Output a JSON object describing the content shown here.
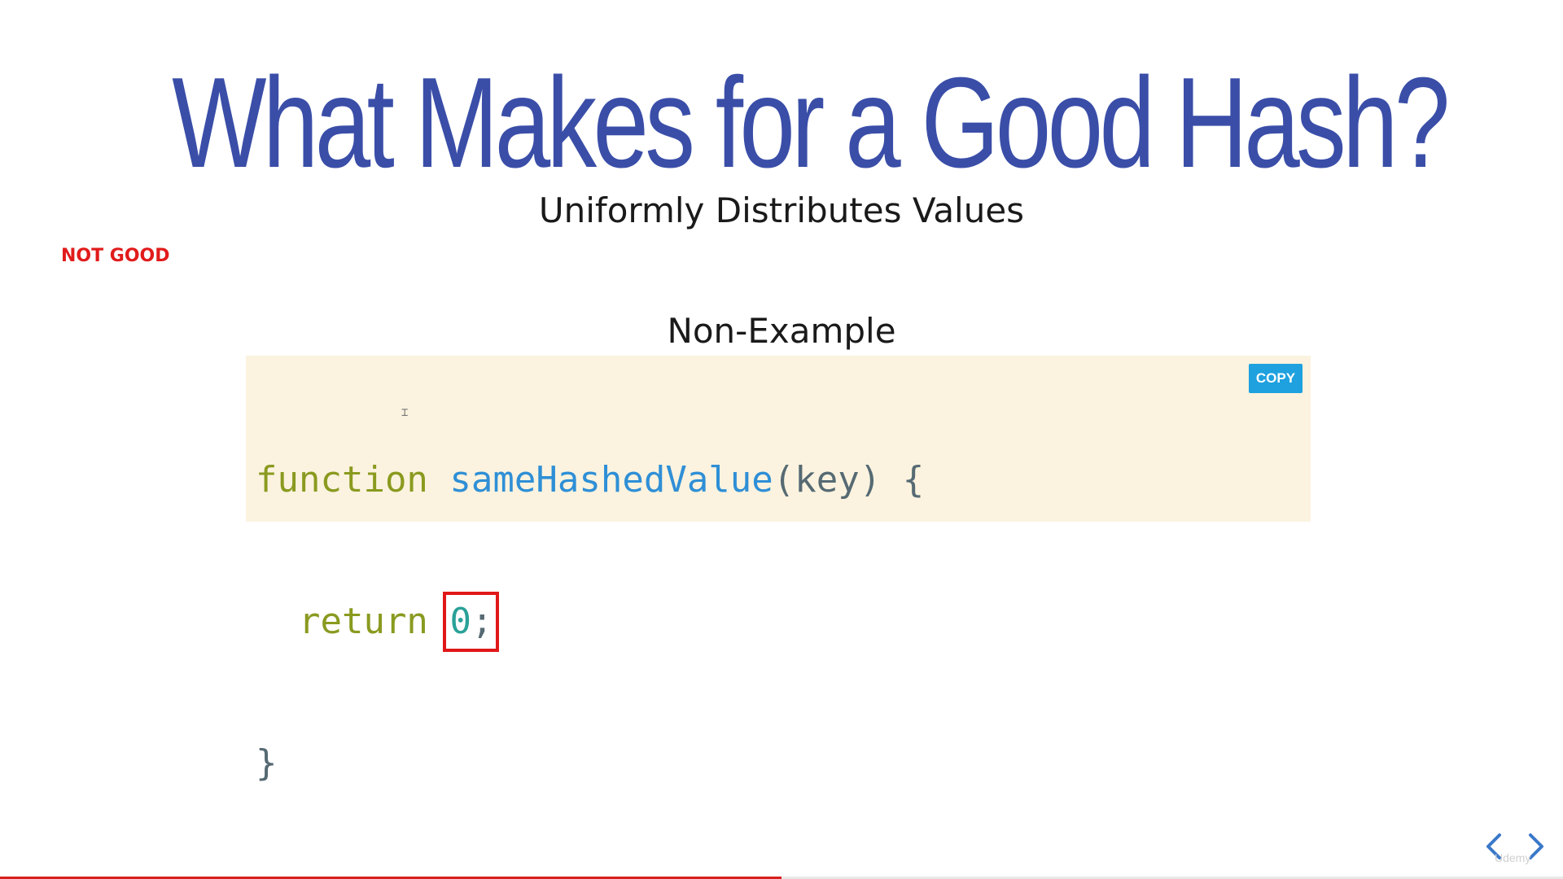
{
  "slide": {
    "title": "What Makes for a Good Hash?",
    "subtitle": "Uniformly Distributes Values",
    "annotation": "NOT GOOD",
    "section_label": "Non-Example"
  },
  "code_block": {
    "copy_label": "COPY",
    "line1": {
      "keyword": "function",
      "name": "sameHashedValue",
      "open_paren": "(",
      "param": "key",
      "close_paren": ")",
      "brace": "{"
    },
    "line2": {
      "keyword": "return",
      "value": "0",
      "semicolon": ";"
    },
    "line3": {
      "brace": "}"
    }
  },
  "player": {
    "progress": 0.5,
    "prev_icon": "chevron-left-icon",
    "next_icon": "chevron-right-icon",
    "watermark": "Udemy"
  },
  "colors": {
    "title": "#3a4ea8",
    "annotation": "#e11b1b",
    "code_background": "#fbf3df",
    "keyword": "#8a9a20",
    "function_name": "#2f8fd6",
    "number": "#2aa198",
    "highlight_box": "#e01818",
    "copy_button": "#1ea1de",
    "progress": "#d81e1e",
    "nav_arrow": "#3a78c9"
  }
}
